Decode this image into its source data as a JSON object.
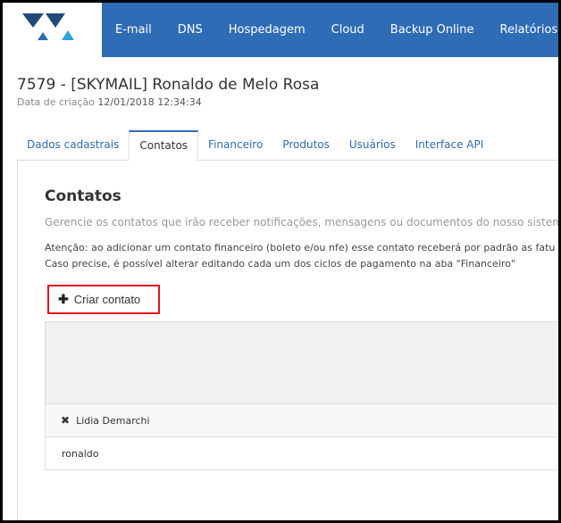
{
  "nav": {
    "items": [
      "E-mail",
      "DNS",
      "Hospedagem",
      "Cloud",
      "Backup Online",
      "Relatórios"
    ],
    "help_icon": "?"
  },
  "header": {
    "title": "7579 - [SKYMAIL] Ronaldo de Melo Rosa",
    "created_label": "Data de criação",
    "created_value": "12/01/2018 12:34:34"
  },
  "tabs": [
    "Dados cadastrais",
    "Contatos",
    "Financeiro",
    "Produtos",
    "Usuários",
    "Interface API"
  ],
  "active_tab": "Contatos",
  "section": {
    "title": "Contatos",
    "description": "Gerencie os contatos que irão receber notificações, mensagens ou documentos do nosso sistema por e",
    "warning_line1": "Atenção: ao adicionar um contato financeiro (boleto e/ou nfe) esse contato receberá por padrão as fatu",
    "warning_line2": "Caso precise, é possível alterar editando cada um dos ciclos de pagamento na aba \"Financeiro\"",
    "create_button": "Criar contato"
  },
  "contacts": [
    {
      "name": "Lidia Demarchi",
      "body": "ronaldo"
    }
  ],
  "icons": {
    "logo": "triangle-logo-icon",
    "plus": "plus-icon",
    "remove": "x-icon"
  },
  "colors": {
    "nav_bg": "#2e6cb5",
    "highlight": "#e3141c"
  }
}
